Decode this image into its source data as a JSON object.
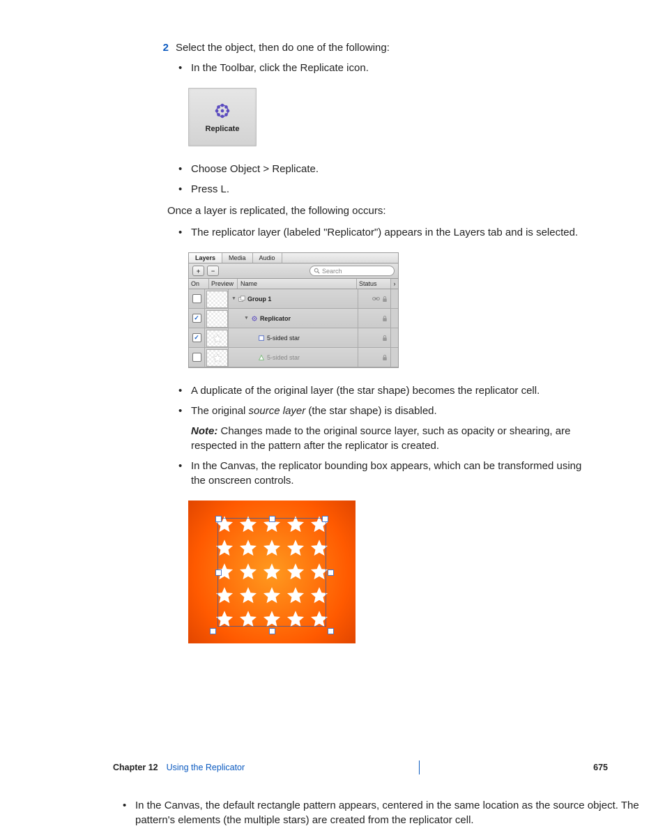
{
  "step": {
    "num": "2",
    "text": "Select the object, then do one of the following:"
  },
  "bullets1": [
    "In the Toolbar, click the Replicate icon.",
    "Choose Object > Replicate.",
    "Press L."
  ],
  "replicate_button_label": "Replicate",
  "para_once": "Once a layer is replicated, the following occurs:",
  "bullets2": {
    "b0": "The replicator layer (labeled \"Replicator\") appears in the Layers tab and is selected."
  },
  "layers_panel": {
    "tabs": [
      "Layers",
      "Media",
      "Audio"
    ],
    "search_placeholder": "Search",
    "headers": {
      "on": "On",
      "preview": "Preview",
      "name": "Name",
      "status": "Status"
    },
    "rows": [
      {
        "checked": false,
        "name": "Group 1",
        "indent": 0,
        "icon": "group",
        "thumb": "grid",
        "locked": true,
        "link": true
      },
      {
        "checked": true,
        "name": "Replicator",
        "indent": 1,
        "icon": "replicator",
        "thumb": "grid",
        "locked": true,
        "link": false
      },
      {
        "checked": true,
        "name": "5-sided star",
        "indent": 2,
        "icon": "shape",
        "thumb": "star",
        "locked": true,
        "link": false
      },
      {
        "checked": false,
        "name": "5-sided star",
        "indent": 2,
        "icon": "shape-off",
        "thumb": "star",
        "locked": true,
        "link": false
      }
    ]
  },
  "bullets3_a": "A duplicate of the original layer (the star shape) becomes the replicator cell.",
  "bullets3_b_pre": "The original ",
  "bullets3_b_it": "source layer",
  "bullets3_b_post": " (the star shape) is disabled.",
  "note_label": "Note:",
  "note_text": "  Changes made to the original source layer, such as opacity or shearing, are respected in the pattern after the replicator is created.",
  "bullets3_c": "In the Canvas, the replicator bounding box appears, which can be transformed using the onscreen controls.",
  "bullets4": "In the Canvas, the default rectangle pattern appears, centered in the same location as the source object. The pattern's elements (the multiple stars) are created from the replicator cell.",
  "footer": {
    "chapter_label": "Chapter 12",
    "chapter_title": "Using the Replicator",
    "page": "675"
  }
}
